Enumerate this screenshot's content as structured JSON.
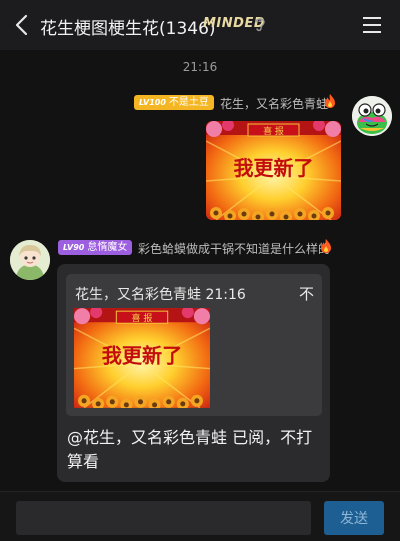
{
  "header": {
    "title": "花生梗图梗生花(1346)",
    "minded": "MINDED",
    "back_icon": "chevron-left-icon",
    "ear_icon": "ear-icon",
    "menu_icon": "menu-icon"
  },
  "time_label": "21:16",
  "messages": [
    {
      "badge_level": "LV100",
      "badge_title": "不是土豆",
      "sender": "花生，又名彩色青蛙",
      "image_banner": "喜 报",
      "image_headline": "我更新了"
    },
    {
      "badge_level": "LV90",
      "badge_title": "怠惰魔女",
      "sender": "彩色蛤蟆做成干锅不知道是什么样的",
      "quote_header": "花生，又名彩色青蛙 21:16",
      "quote_close": "不",
      "quote_banner": "喜 报",
      "quote_headline": "我更新了",
      "reply_text": "@花生，又名彩色青蛙 已阅，不打算看"
    }
  ],
  "input": {
    "value": "",
    "placeholder": ""
  },
  "send_label": "发送"
}
